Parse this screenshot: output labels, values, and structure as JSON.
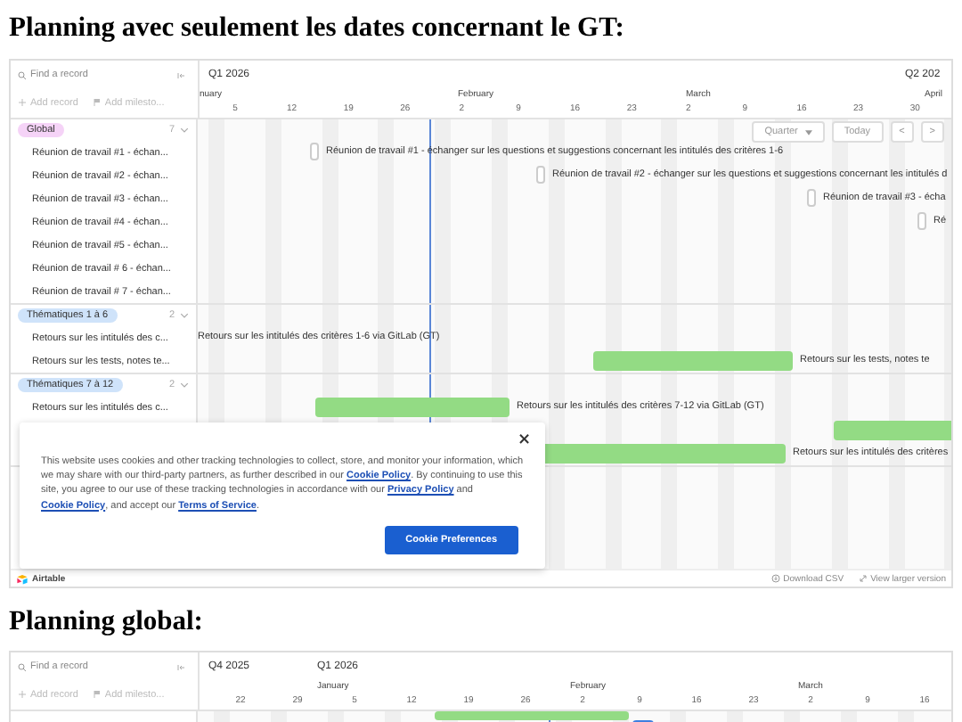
{
  "embeds": [
    {
      "heading": "Planning avec seulement les dates concernant le GT:",
      "search": {
        "placeholder": "Find a record"
      },
      "add_record": "Add record",
      "add_milestone": "Add milesto...",
      "quarters": [
        "Q1 2026",
        "Q2 202"
      ],
      "months": [
        "nuary",
        "February",
        "March",
        "April"
      ],
      "days": [
        "5",
        "12",
        "19",
        "26",
        "2",
        "9",
        "16",
        "23",
        "2",
        "9",
        "16",
        "23",
        "30"
      ],
      "controls": {
        "zoom": "Quarter",
        "today": "Today",
        "prev": "<",
        "next": ">"
      },
      "groups": [
        {
          "label": "Global",
          "count": "7",
          "color": "#f5d3f7",
          "records": [
            {
              "name": "Réunion de travail #1 - échan...",
              "kind": "milestone",
              "bar_label": "Réunion de travail #1 - échanger sur les questions et suggestions concernant les intitulés des critères 1-6"
            },
            {
              "name": "Réunion de travail #2 - échan...",
              "kind": "milestone",
              "bar_label": "Réunion de travail #2 - échanger sur les questions et suggestions concernant les intitulés d"
            },
            {
              "name": "Réunion de travail #3 - échan...",
              "kind": "milestone",
              "bar_label": "Réunion de travail #3 - écha"
            },
            {
              "name": "Réunion de travail #4 - échan...",
              "kind": "milestone",
              "bar_label": "Ré"
            },
            {
              "name": "Réunion de travail #5 - échan..."
            },
            {
              "name": "Réunion de travail # 6 - échan..."
            },
            {
              "name": "Réunion de travail # 7 - échan..."
            }
          ]
        },
        {
          "label": "Thématiques 1 à 6",
          "count": "2",
          "color": "#cfe3fa",
          "records": [
            {
              "name": "Retours sur les intitulés des c...",
              "kind": "bar",
              "bar_label": "Retours sur les intitulés des critères 1-6 via GitLab (GT)"
            },
            {
              "name": "Retours sur les tests, notes te...",
              "kind": "bar",
              "bar_label": "Retours sur les tests, notes te"
            }
          ]
        },
        {
          "label": "Thématiques 7 à 12",
          "count": "2",
          "color": "#cfe3fa",
          "records": [
            {
              "name": "Retours sur les intitulés des c...",
              "kind": "bar",
              "bar_label": "Retours sur les intitulés des critères 7-12 via GitLab (GT)"
            },
            {
              "kind": "bar"
            },
            {
              "kind": "bar",
              "bar_label": "Retours sur les intitulés des critères"
            }
          ]
        }
      ],
      "cookie": {
        "parts": [
          {
            "kind": "text",
            "text": "This website uses cookies and other tracking technologies to collect, store, and monitor your information, which we may share with our third-party partners, as further described in our "
          },
          {
            "kind": "link",
            "text": "Cookie Policy"
          },
          {
            "kind": "text",
            "text": ". By continuing to use this site, you agree to our use of these tracking technologies in accordance with our "
          },
          {
            "kind": "link",
            "text": "Privacy Policy"
          },
          {
            "kind": "text",
            "text": " and "
          },
          {
            "kind": "link",
            "text": "Cookie Policy"
          },
          {
            "kind": "text",
            "text": ", and accept our "
          },
          {
            "kind": "link",
            "text": "Terms of Service"
          },
          {
            "kind": "text",
            "text": "."
          }
        ],
        "close": "×",
        "button": "Cookie Preferences"
      },
      "footer": {
        "brand": "Airtable",
        "download": "Download CSV",
        "larger": "View larger version"
      }
    },
    {
      "heading": "Planning global:",
      "search": {
        "placeholder": "Find a record"
      },
      "add_record": "Add record",
      "add_milestone": "Add milesto...",
      "quarters": [
        "Q4 2025",
        "Q1 2026"
      ],
      "months": [
        "January",
        "February",
        "March"
      ],
      "days": [
        "22",
        "29",
        "5",
        "12",
        "19",
        "26",
        "2",
        "9",
        "16",
        "23",
        "2",
        "9",
        "16"
      ],
      "groups": [
        {
          "records": [
            {
              "kind": "bar",
              "color": "#93db84"
            },
            {
              "kind": "bar",
              "color": "#3f7fe0"
            }
          ]
        }
      ]
    }
  ]
}
